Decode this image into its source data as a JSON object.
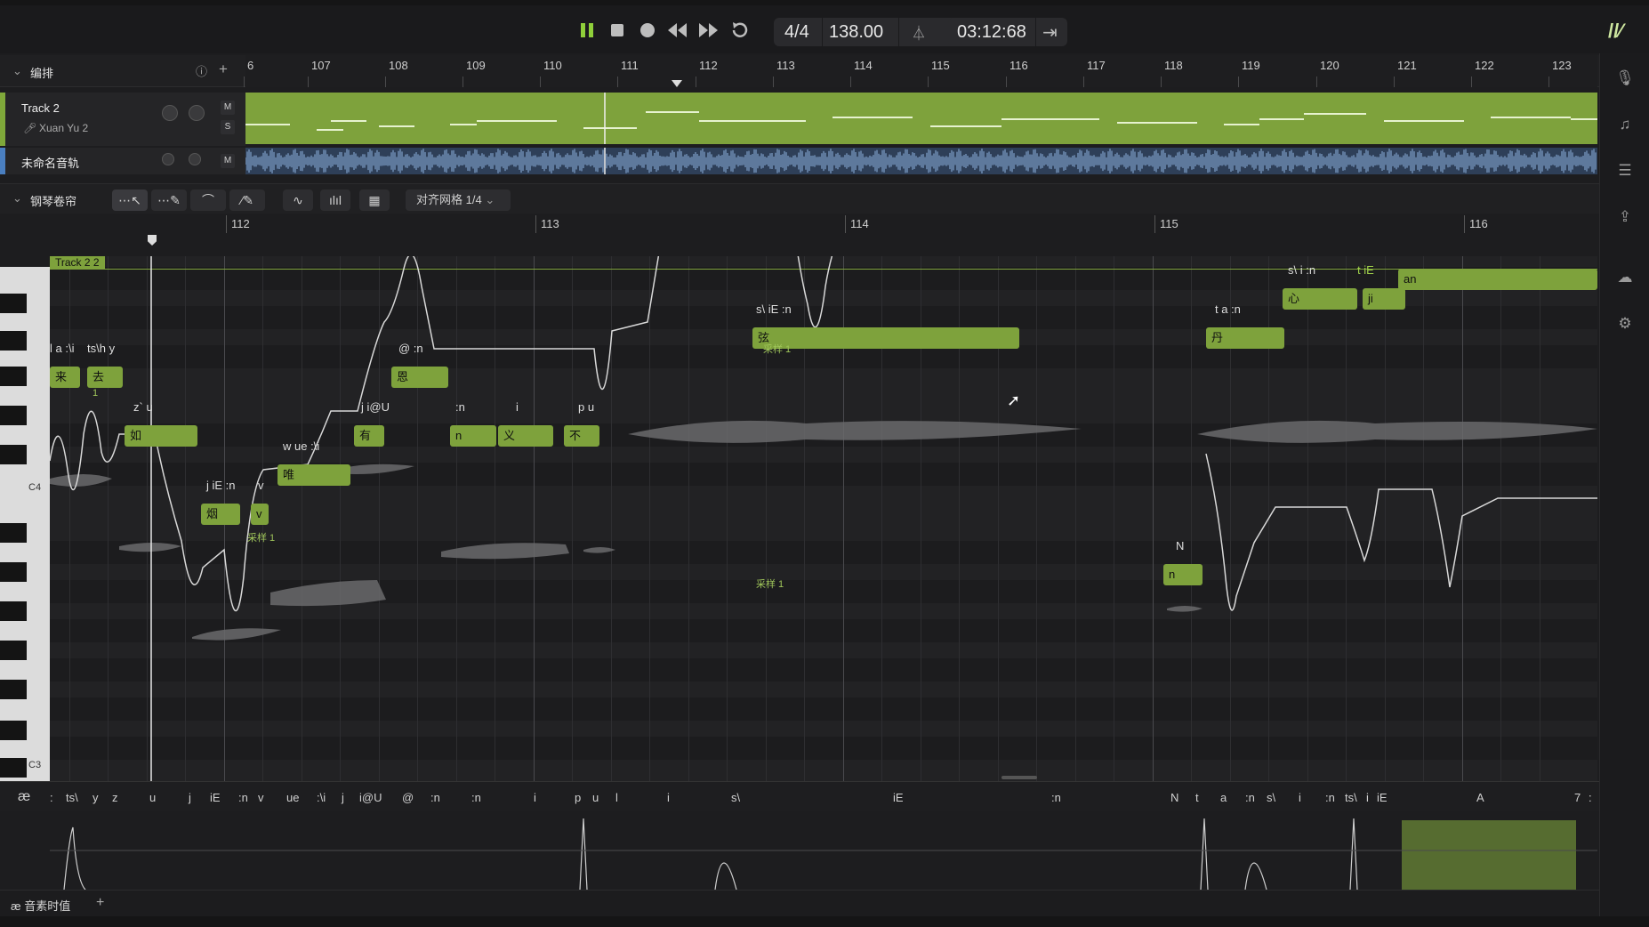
{
  "transport": {
    "time_signature": "4/4",
    "tempo": "138.00",
    "position": "03:12:68",
    "icons": [
      "pause-icon",
      "stop-icon",
      "record-icon",
      "rewind-icon",
      "fast-forward-icon",
      "loop-icon",
      "metronome-icon",
      "follow-icon"
    ]
  },
  "arrangement": {
    "title": "编排",
    "ruler": [
      "6",
      "107",
      "108",
      "109",
      "110",
      "111",
      "112",
      "113",
      "114",
      "115",
      "116",
      "117",
      "118",
      "119",
      "120",
      "121",
      "122",
      "123"
    ],
    "tracks": [
      {
        "name": "Track 2",
        "singer": "Xuan Yu 2",
        "mute": "M",
        "solo": "S"
      },
      {
        "name": "未命名音轨",
        "mute": "M"
      }
    ]
  },
  "piano_roll": {
    "title": "钢琴卷帘",
    "snap": "对齐网格 1/4",
    "ruler": [
      "112",
      "113",
      "114",
      "115",
      "116"
    ],
    "clip_label": "Track 2 2",
    "key_labels": [
      "C4",
      "C3"
    ],
    "notes": [
      {
        "lyric": "来",
        "phoneme": "l a :\\i"
      },
      {
        "lyric": "去",
        "phoneme": "ts\\h y"
      },
      {
        "lyric": "如",
        "phoneme": "z` u"
      },
      {
        "lyric": "烟",
        "phoneme": "j iE :n"
      },
      {
        "lyric": "v",
        "phoneme": "v"
      },
      {
        "lyric": "唯",
        "phoneme": "w ue :\\i"
      },
      {
        "lyric": "有",
        "phoneme": "j i@U"
      },
      {
        "lyric": "恩",
        "phoneme": "@ :n"
      },
      {
        "lyric": "n",
        "phoneme": ":n"
      },
      {
        "lyric": "义",
        "phoneme": "i"
      },
      {
        "lyric": "不",
        "phoneme": "p u"
      },
      {
        "lyric": "弦",
        "phoneme": "s\\ iE :n"
      },
      {
        "lyric": "n",
        "phoneme": "N"
      },
      {
        "lyric": "丹",
        "phoneme": "t a :n"
      },
      {
        "lyric": "心",
        "phoneme": "s\\ i :n"
      },
      {
        "lyric": "ji",
        "phoneme": "t  iE"
      },
      {
        "lyric": "an",
        "phoneme": "A 7 :n"
      }
    ],
    "sample_tags": [
      "采样 1",
      "采样 1",
      "采样 1",
      "1"
    ]
  },
  "phonemes": [
    ":",
    "ts\\",
    "y",
    "z",
    "u",
    "j",
    "iE",
    ":n",
    "v",
    "ue",
    ":\\i",
    "j",
    "i@U",
    "@",
    ":n",
    ":n",
    "i",
    "p",
    "u",
    "l",
    "i",
    "s\\",
    "iE",
    ":n",
    "N",
    "t",
    "a",
    ":n",
    "s\\",
    "i",
    ":n",
    "ts\\",
    "i",
    "iE",
    "A",
    "7",
    ":"
  ],
  "phoneme_icon": "æ",
  "footer": {
    "tab": "音素时值",
    "add": "+"
  }
}
